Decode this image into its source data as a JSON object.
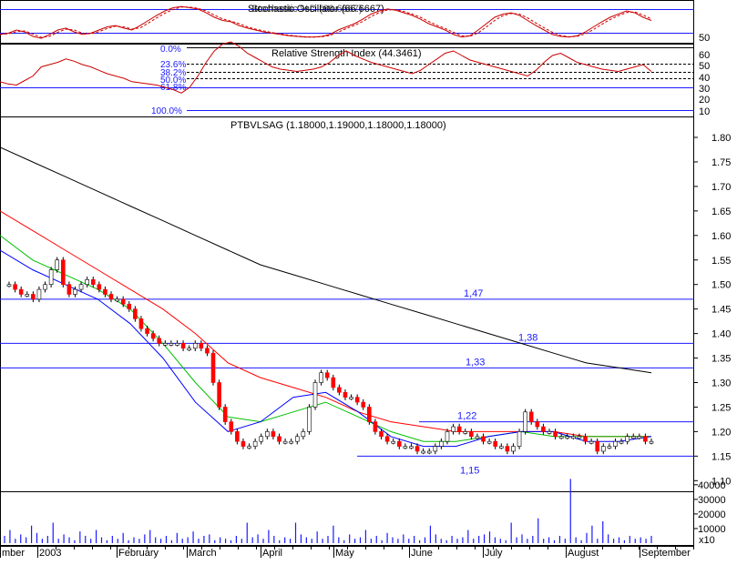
{
  "chart_data": [
    {
      "panel": "stochastic",
      "type": "line",
      "title": "Stochastic Oscillator (66.6667)",
      "overlay_text": "Stochastic %D (66.6667)",
      "y_ticks": [
        "50"
      ],
      "series": [
        {
          "values": [
            48,
            50,
            55,
            52,
            45,
            42,
            48,
            55,
            58,
            52,
            48,
            50,
            55,
            60,
            62,
            58,
            55,
            62,
            70,
            78,
            85,
            90,
            92,
            90,
            88,
            82,
            75,
            70,
            68,
            62,
            58,
            55,
            52,
            50,
            48,
            46,
            45,
            44,
            44,
            45,
            48,
            55,
            60,
            65,
            72,
            80,
            85,
            88,
            86,
            82,
            78,
            72,
            65,
            60,
            55,
            48,
            44,
            46,
            55,
            65,
            75,
            80,
            82,
            78,
            70,
            62,
            55,
            48,
            45,
            44,
            46,
            52,
            60,
            68,
            75,
            80,
            85,
            82,
            75,
            70
          ]
        }
      ]
    },
    {
      "panel": "rsi",
      "type": "line",
      "title": "Relative Strength Index (44.3461)",
      "y_ticks": [
        "60",
        "50",
        "40",
        "30",
        "20",
        "10"
      ],
      "fib_levels": [
        {
          "label": "0.0%"
        },
        {
          "label": "23.6%"
        },
        {
          "label": "38.2%"
        },
        {
          "label": "50.0%"
        },
        {
          "label": "61.8%"
        },
        {
          "label": "100.0%"
        }
      ],
      "series": [
        {
          "values": [
            35,
            33,
            32,
            36,
            40,
            48,
            50,
            52,
            55,
            53,
            50,
            48,
            45,
            42,
            40,
            38,
            35,
            34,
            33,
            32,
            30,
            28,
            25,
            30,
            40,
            52,
            62,
            68,
            70,
            66,
            60,
            56,
            52,
            48,
            46,
            45,
            44,
            45,
            46,
            48,
            52,
            58,
            62,
            58,
            55,
            52,
            50,
            48,
            46,
            44,
            42,
            45,
            50,
            55,
            60,
            62,
            58,
            54,
            52,
            50,
            48,
            46,
            44,
            42,
            40,
            45,
            52,
            58,
            60,
            56,
            52,
            50,
            48,
            46,
            45,
            44,
            46,
            48,
            50,
            44
          ]
        }
      ]
    },
    {
      "panel": "price",
      "type": "candlestick",
      "title": "PTBVLSAG (1.18000,1.19000,1.18000,1.18000)",
      "ylim": [
        1.1,
        1.82
      ],
      "y_ticks": [
        "1.80",
        "1.75",
        "1.70",
        "1.65",
        "1.60",
        "1.55",
        "1.50",
        "1.45",
        "1.40",
        "1.35",
        "1.30",
        "1.25",
        "1.20",
        "1.15",
        "1.10"
      ],
      "x_ticks": [
        "mber",
        "2003",
        "February",
        "March",
        "April",
        "May",
        "June",
        "July",
        "August",
        "September"
      ],
      "close": [
        1.5,
        1.49,
        1.48,
        1.48,
        1.47,
        1.49,
        1.5,
        1.53,
        1.55,
        1.5,
        1.48,
        1.49,
        1.5,
        1.51,
        1.5,
        1.49,
        1.48,
        1.47,
        1.47,
        1.46,
        1.45,
        1.43,
        1.41,
        1.4,
        1.39,
        1.38,
        1.38,
        1.38,
        1.38,
        1.37,
        1.37,
        1.38,
        1.37,
        1.36,
        1.3,
        1.25,
        1.22,
        1.2,
        1.18,
        1.17,
        1.17,
        1.18,
        1.19,
        1.2,
        1.19,
        1.18,
        1.18,
        1.18,
        1.19,
        1.2,
        1.25,
        1.3,
        1.32,
        1.31,
        1.29,
        1.28,
        1.27,
        1.27,
        1.26,
        1.25,
        1.22,
        1.2,
        1.19,
        1.18,
        1.18,
        1.17,
        1.17,
        1.17,
        1.16,
        1.16,
        1.16,
        1.17,
        1.18,
        1.2,
        1.21,
        1.2,
        1.2,
        1.19,
        1.19,
        1.18,
        1.18,
        1.17,
        1.17,
        1.16,
        1.17,
        1.2,
        1.24,
        1.22,
        1.21,
        1.2,
        1.2,
        1.19,
        1.19,
        1.19,
        1.19,
        1.19,
        1.18,
        1.18,
        1.16,
        1.17,
        1.17,
        1.18,
        1.18,
        1.19,
        1.19,
        1.19,
        1.18,
        1.18
      ],
      "series": [
        {
          "name": "",
          "color": "#000000",
          "values": [
            1.78,
            1.75,
            1.72,
            1.69,
            1.66,
            1.63,
            1.6,
            1.57,
            1.54,
            1.52,
            1.5,
            1.48,
            1.46,
            1.44,
            1.42,
            1.4,
            1.38,
            1.36,
            1.34,
            1.33,
            1.32
          ]
        },
        {
          "name": "",
          "color": "#ff0000",
          "values": [
            1.65,
            1.61,
            1.57,
            1.53,
            1.49,
            1.45,
            1.4,
            1.34,
            1.31,
            1.29,
            1.27,
            1.24,
            1.22,
            1.21,
            1.2,
            1.2,
            1.2,
            1.2,
            1.19,
            1.19,
            1.19
          ]
        },
        {
          "name": "",
          "color": "#00c000",
          "values": [
            1.6,
            1.55,
            1.52,
            1.49,
            1.45,
            1.38,
            1.3,
            1.23,
            1.22,
            1.24,
            1.26,
            1.23,
            1.2,
            1.18,
            1.18,
            1.19,
            1.2,
            1.19,
            1.19,
            1.19,
            1.19
          ]
        },
        {
          "name": "",
          "color": "#0000ff",
          "values": [
            1.57,
            1.53,
            1.5,
            1.47,
            1.42,
            1.35,
            1.26,
            1.2,
            1.22,
            1.27,
            1.28,
            1.24,
            1.19,
            1.17,
            1.17,
            1.19,
            1.2,
            1.2,
            1.18,
            1.18,
            1.19
          ]
        }
      ],
      "hlines": [
        {
          "value": 1.47,
          "label": "1,47"
        },
        {
          "value": 1.38,
          "label": "1,38"
        },
        {
          "value": 1.33,
          "label": "1,33"
        },
        {
          "value": 1.22,
          "label": "1,22"
        },
        {
          "value": 1.15,
          "label": "1,15"
        }
      ]
    },
    {
      "panel": "volume",
      "type": "bar",
      "unit_label": "x10",
      "y_ticks": [
        "40000",
        "30000",
        "20000",
        "10000"
      ],
      "ylim": [
        0,
        50000
      ],
      "values": [
        5000,
        9000,
        3000,
        6000,
        4000,
        12000,
        7000,
        3000,
        5000,
        14000,
        3000,
        6000,
        4000,
        2000,
        8000,
        5000,
        3000,
        9000,
        4000,
        2000,
        5000,
        3000,
        7000,
        2000,
        4000,
        3000,
        6000,
        9000,
        4000,
        3000,
        5000,
        2000,
        7000,
        3000,
        4000,
        8000,
        3000,
        5000,
        6000,
        2000,
        4000,
        3000,
        2000,
        5000,
        3000,
        14000,
        4000,
        6000,
        3000,
        9000,
        5000,
        2000,
        4000,
        3000,
        14000,
        6000,
        4000,
        3000,
        8000,
        3000,
        5000,
        12000,
        4000,
        2000,
        6000,
        3000,
        4000,
        9000,
        3000,
        5000,
        2000,
        7000,
        4000,
        3000,
        6000,
        3000,
        5000,
        2000,
        4000,
        12000,
        6000,
        3000,
        2000,
        5000,
        3000,
        4000,
        9000,
        3000,
        5000,
        6000,
        8000,
        4000,
        3000,
        2000,
        14000,
        4000,
        6000,
        3000,
        5000,
        17000,
        3000,
        4000,
        2000,
        5000,
        3000,
        44000,
        4000,
        2000,
        7000,
        12000,
        3000,
        15000,
        6000,
        3000,
        4000,
        2000,
        5000,
        3000,
        4000,
        3000,
        5000
      ]
    }
  ]
}
